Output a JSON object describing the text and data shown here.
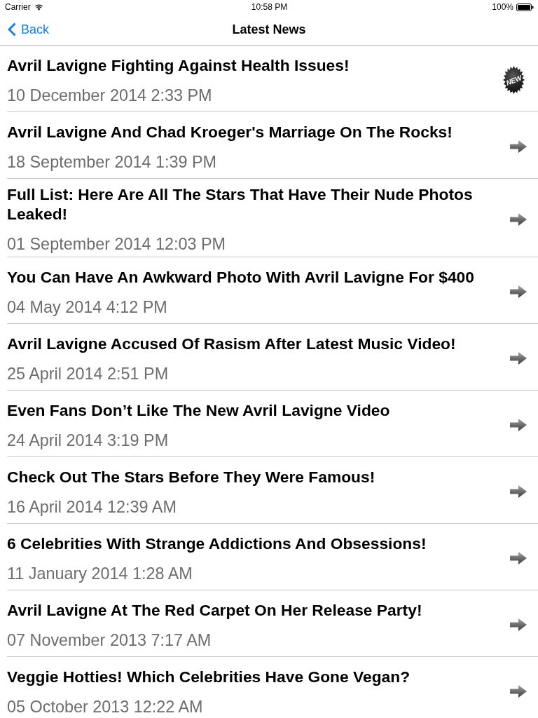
{
  "status_bar": {
    "carrier": "Carrier",
    "time": "10:58 PM",
    "battery": "100%"
  },
  "nav_bar": {
    "back": "Back",
    "title": "Latest News"
  },
  "news": [
    {
      "title": "Avril Lavigne Fighting Against Health Issues!",
      "date": "10 December 2014 2:33 PM",
      "kind": "new",
      "badge": "NEW"
    },
    {
      "title": "Avril Lavigne And Chad Kroeger's Marriage On The Rocks!",
      "date": "18 September 2014 1:39 PM",
      "kind": "arrow"
    },
    {
      "title": "Full List: Here Are All The Stars That Have Their Nude Photos Leaked!",
      "date": "01 September 2014 12:03 PM",
      "kind": "arrow"
    },
    {
      "title": "You Can Have An Awkward Photo With Avril Lavigne For $400",
      "date": "04 May 2014 4:12 PM",
      "kind": "arrow"
    },
    {
      "title": "Avril Lavigne Accused Of Rasism After Latest Music Video!",
      "date": "25 April 2014 2:51 PM",
      "kind": "arrow"
    },
    {
      "title": "Even Fans Don’t Like The New Avril Lavigne Video",
      "date": "24 April 2014 3:19 PM",
      "kind": "arrow"
    },
    {
      "title": "Check Out The Stars Before They Were Famous!",
      "date": "16 April 2014 12:39 AM",
      "kind": "arrow"
    },
    {
      "title": "6 Celebrities With Strange Addictions And Obsessions!",
      "date": "11 January 2014 1:28 AM",
      "kind": "arrow"
    },
    {
      "title": "Avril Lavigne At The Red Carpet On Her Release Party!",
      "date": "07 November 2013 7:17 AM",
      "kind": "arrow"
    },
    {
      "title": "Veggie Hotties! Which Celebrities Have Gone Vegan?",
      "date": "05 October 2013 12:22 AM",
      "kind": "arrow"
    }
  ]
}
